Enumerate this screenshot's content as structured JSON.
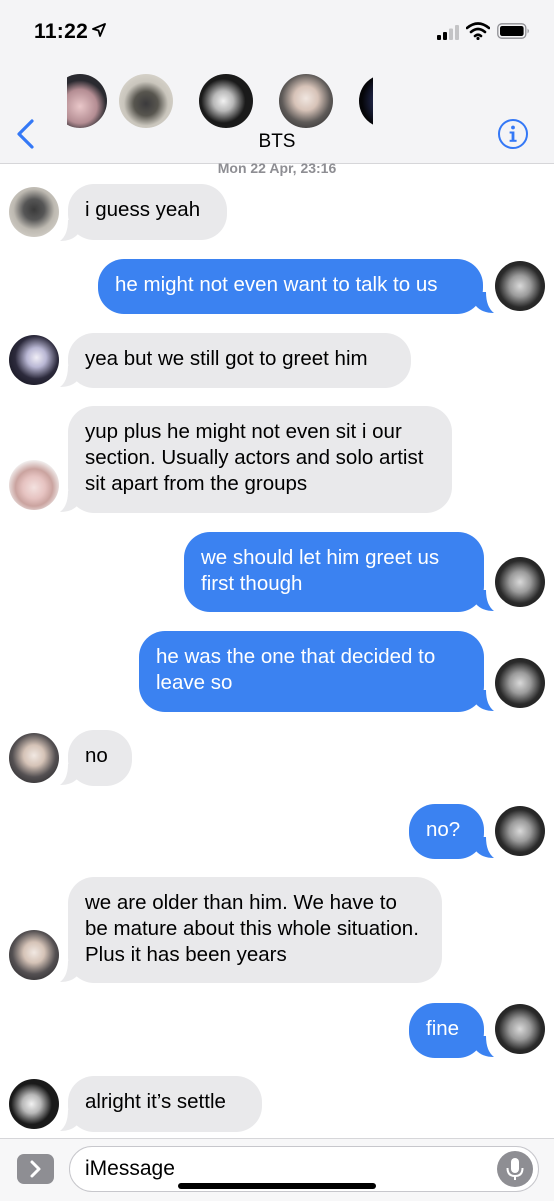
{
  "status_bar": {
    "time": "11:22"
  },
  "header": {
    "group_name": "BTS",
    "timestamp": "Mon 22 Apr, 23:16"
  },
  "messages": [
    {
      "from": "incoming",
      "text": "i guess yeah"
    },
    {
      "from": "outgoing",
      "text": "he might not even want to talk to us"
    },
    {
      "from": "incoming",
      "text": "yea but we still got to greet him"
    },
    {
      "from": "incoming",
      "text": "yup plus he might not even sit i our section. Usually actors and solo artist sit apart from the groups"
    },
    {
      "from": "outgoing",
      "text": "we should let him greet us first though"
    },
    {
      "from": "outgoing",
      "text": "he was the one that decided to leave so"
    },
    {
      "from": "incoming",
      "text": "no"
    },
    {
      "from": "outgoing",
      "text": "no?"
    },
    {
      "from": "incoming",
      "text": "we are older than him. We have to be mature about this whole situation. Plus it has been years"
    },
    {
      "from": "outgoing",
      "text": "fine"
    },
    {
      "from": "incoming",
      "text": "alright it’s settle"
    }
  ],
  "input": {
    "placeholder": "iMessage"
  },
  "colors": {
    "outgoing_bubble": "#3b82f1",
    "incoming_bubble": "#e9e9eb",
    "accent": "#3478f6"
  }
}
